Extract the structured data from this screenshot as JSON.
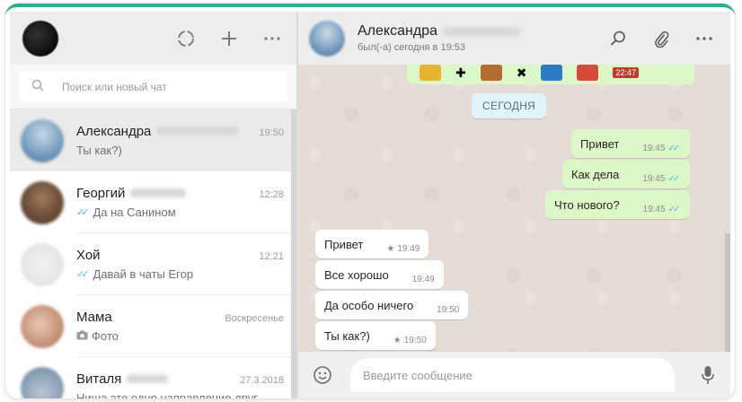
{
  "search": {
    "placeholder": "Поиск или новый чат"
  },
  "chats": [
    {
      "name": "Александра",
      "time": "19:50",
      "preview": "Ты как?)",
      "preview_icon": "",
      "active": true
    },
    {
      "name": "Георгий",
      "time": "12:28",
      "preview": "Да на Санином",
      "preview_icon": "double-check-icon",
      "active": false
    },
    {
      "name": "Хой",
      "time": "12:21",
      "preview": "Давай в чаты Егор",
      "preview_icon": "double-check-icon",
      "active": false
    },
    {
      "name": "Мама",
      "time": "Воскресенье",
      "preview": "Фото",
      "preview_icon": "camera-icon",
      "active": false
    },
    {
      "name": "Виталя",
      "time": "27.3.2018",
      "preview": "Ниша это одно направление друг...",
      "preview_icon": "",
      "active": false
    }
  ],
  "contact": {
    "name": "Александра",
    "status": "был(-а) сегодня в 19:53"
  },
  "conversation": {
    "sticker_time": "22:47",
    "date_chip": "СЕГОДНЯ",
    "messages": [
      {
        "dir": "out",
        "text": "Привет",
        "time": "19:45",
        "ticks": true,
        "starred": false
      },
      {
        "dir": "out",
        "text": "Как дела",
        "time": "19:45",
        "ticks": true,
        "starred": false
      },
      {
        "dir": "out",
        "text": "Что нового?",
        "time": "19:45",
        "ticks": true,
        "starred": false
      },
      {
        "dir": "in",
        "text": "Привет",
        "time": "19:49",
        "ticks": false,
        "starred": true
      },
      {
        "dir": "in",
        "text": "Все хорошо",
        "time": "19:49",
        "ticks": false,
        "starred": false
      },
      {
        "dir": "in",
        "text": "Да особо ничего",
        "time": "19:50",
        "ticks": false,
        "starred": false
      },
      {
        "dir": "in",
        "text": "Ты как?)",
        "time": "19:50",
        "ticks": false,
        "starred": true
      }
    ]
  },
  "composer": {
    "placeholder": "Введите сообщение"
  },
  "colors": {
    "accent": "#28b08d",
    "outgoing_bubble": "#dcf8c6",
    "incoming_bubble": "#ffffff",
    "tick_blue": "#4fb6ec",
    "chat_bg": "#e5ddd5"
  }
}
